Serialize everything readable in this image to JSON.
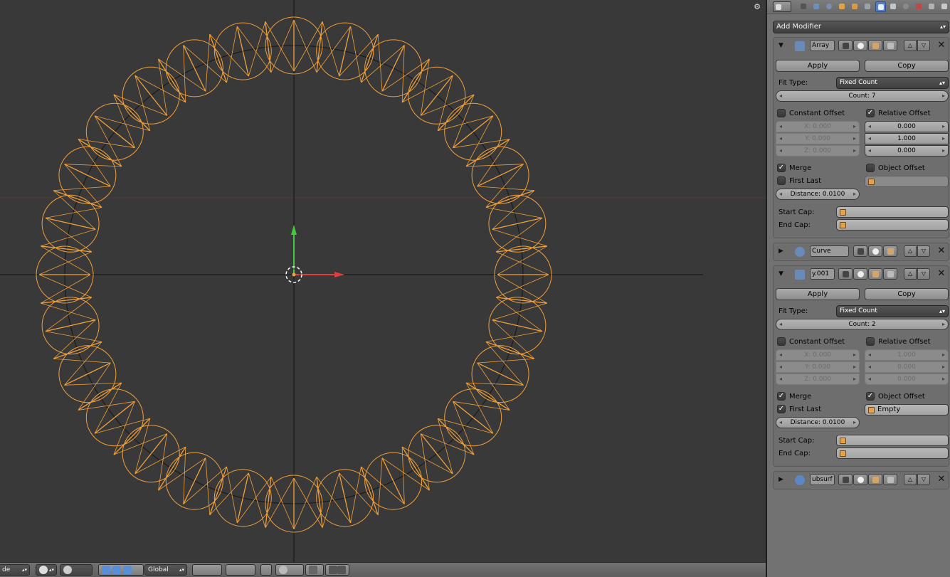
{
  "viewport": {
    "gear_icon": "gear-icon",
    "colors": {
      "background": "#393939",
      "wire": "#f2a03a",
      "x_axis": "#e23d3d",
      "y_axis": "#43c93d"
    }
  },
  "footer": {
    "mode_label": "de",
    "orientation_label": "Global"
  },
  "panel": {
    "add_modifier": "Add Modifier",
    "modifiers": [
      {
        "name": "Array",
        "expanded": true,
        "apply_label": "Apply",
        "copy_label": "Copy",
        "fit_type_label": "Fit Type:",
        "fit_type_value": "Fixed Count",
        "count": "Count: 7",
        "constant_offset_label": "Constant Offset",
        "constant_offset_checked": false,
        "constant": [
          "X: 0.000",
          "Y: 0.000",
          "Z: 0.000"
        ],
        "relative_offset_label": "Relative Offset",
        "relative_offset_checked": true,
        "relative": [
          "0.000",
          "1.000",
          "0.000"
        ],
        "merge_label": "Merge",
        "merge_checked": true,
        "object_offset_label": "Object Offset",
        "object_offset_checked": false,
        "object_offset_value": "",
        "first_last_label": "First Last",
        "first_last_checked": false,
        "distance": "Distance: 0.0100",
        "start_cap_label": "Start Cap:",
        "end_cap_label": "End Cap:"
      },
      {
        "name": "Curve",
        "expanded": false
      },
      {
        "name": "y.001",
        "expanded": true,
        "apply_label": "Apply",
        "copy_label": "Copy",
        "fit_type_label": "Fit Type:",
        "fit_type_value": "Fixed Count",
        "count": "Count: 2",
        "constant_offset_label": "Constant Offset",
        "constant_offset_checked": false,
        "constant": [
          "X: 0.000",
          "Y: 0.000",
          "Z: 0.000"
        ],
        "relative_offset_label": "Relative Offset",
        "relative_offset_checked": false,
        "relative": [
          "1.000",
          "0.000",
          "0.000"
        ],
        "merge_label": "Merge",
        "merge_checked": true,
        "object_offset_label": "Object Offset",
        "object_offset_checked": true,
        "object_offset_value": "Empty",
        "first_last_label": "First Last",
        "first_last_checked": true,
        "distance": "Distance: 0.0100",
        "start_cap_label": "Start Cap:",
        "end_cap_label": "End Cap:"
      },
      {
        "name": "ubsurf",
        "expanded": false
      }
    ]
  }
}
